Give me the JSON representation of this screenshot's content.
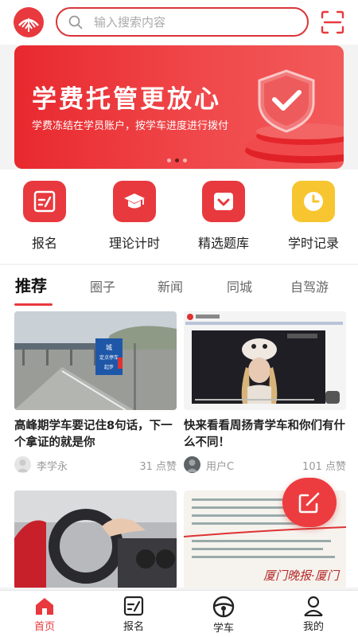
{
  "search": {
    "placeholder": "输入搜索内容"
  },
  "banner": {
    "title": "学费托管更放心",
    "subtitle": "学费冻结在学员账户，按学车进度进行拨付",
    "slides": 3,
    "active_slide": 2
  },
  "quick_actions": [
    {
      "label": "报名",
      "icon": "signup-icon"
    },
    {
      "label": "理论计时",
      "icon": "graduation-cap-icon"
    },
    {
      "label": "精选题库",
      "icon": "heart-check-icon"
    },
    {
      "label": "学时记录",
      "icon": "clock-icon"
    }
  ],
  "tabs": [
    "推荐",
    "圈子",
    "新闻",
    "同城",
    "自驾游"
  ],
  "active_tab": "推荐",
  "posts": [
    {
      "title": "高峰期学车要记住8句话，下一个拿证的就是你",
      "author": "李学永",
      "likes": "31 点赞"
    },
    {
      "title": "快来看看周扬青学车和你们有什么不同！",
      "author": "用户C",
      "likes": "101 点赞"
    },
    {
      "title": "",
      "author": "",
      "likes": ""
    },
    {
      "title": "",
      "author": "",
      "likes": ""
    }
  ],
  "post_images": {
    "toll_sign": [
      "城",
      "定点停车",
      "起步"
    ],
    "newspaper": "厦门晚报·厦门"
  },
  "bottom_nav": [
    {
      "label": "首页",
      "icon": "home-icon",
      "active": true
    },
    {
      "label": "报名",
      "icon": "signup-icon"
    },
    {
      "label": "学车",
      "icon": "steering-wheel-icon"
    },
    {
      "label": "我的",
      "icon": "user-icon"
    }
  ],
  "colors": {
    "brand": "#e8393e",
    "accent_yellow": "#f7c52f",
    "text": "#222222",
    "muted": "#999999"
  }
}
